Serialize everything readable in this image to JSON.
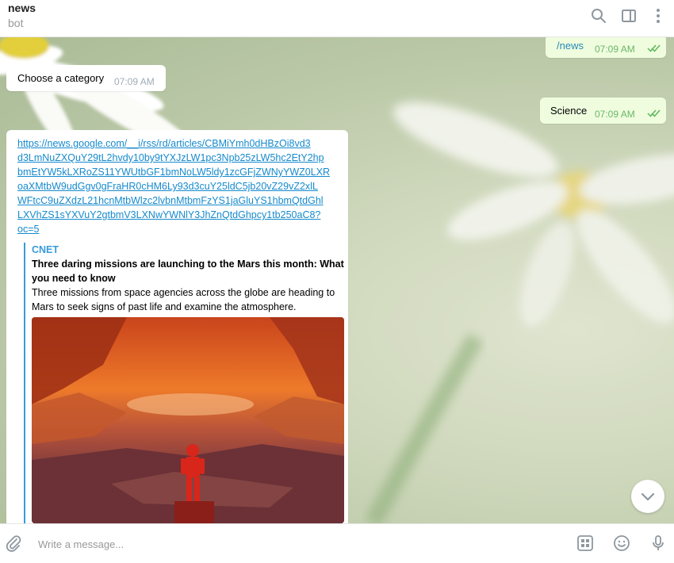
{
  "header": {
    "title": "news",
    "subtitle": "bot",
    "icons": [
      "search-icon",
      "sidebar-toggle-icon",
      "more-vertical-icon"
    ]
  },
  "messages": {
    "news_cmd": {
      "text": "/news",
      "time": "07:09 AM",
      "status": "read"
    },
    "choose_category": {
      "text": "Choose a category",
      "time": "07:09 AM"
    },
    "science": {
      "text": "Science",
      "time": "07:09 AM",
      "status": "read"
    },
    "article": {
      "link_lines": [
        "https://news.google.com/__i/rss/rd/articles/CBMiYmh0dHBzOi8vd3",
        "d3LmNuZXQuY29tL2hvdy10by9tYXJzLW1pc3Npb25zLW5hc2EtY2hp",
        "bmEtYW5kLXRoZS11YWUtbGF1bmNoLW5ldy1zcGFjZWNyYWZ0LXR",
        "oaXMtbW9udGgv0gFraHR0cHM6Ly93d3cuY25ldC5jb20vZ29vZ2xlL",
        "WFtcC9uZXdzL21hcnMtbWlzc2lvbnMtbmFzYS1jaGluYS1hbmQtdGhl",
        "LXVhZS1sYXVuY2gtbmV3LXNwYWNlY3JhZnQtdGhpcy1tb250aC8?",
        "oc=5"
      ],
      "site_name": "CNET",
      "title": "Three daring missions are launching to the Mars this month: What you need to know",
      "description": "Three missions from space agencies across the globe are heading to Mars to seek signs of past life and examine the atmosphere."
    }
  },
  "input": {
    "placeholder": "Write a message...",
    "value": "",
    "icons": [
      "attach-icon",
      "bot-keyboard-icon",
      "emoji-icon",
      "microphone-icon"
    ]
  },
  "colors": {
    "outgoing_bubble": "#effdde",
    "link": "#168acd",
    "read_check": "#5fb55d",
    "preview_accent": "#3a9ad9"
  }
}
